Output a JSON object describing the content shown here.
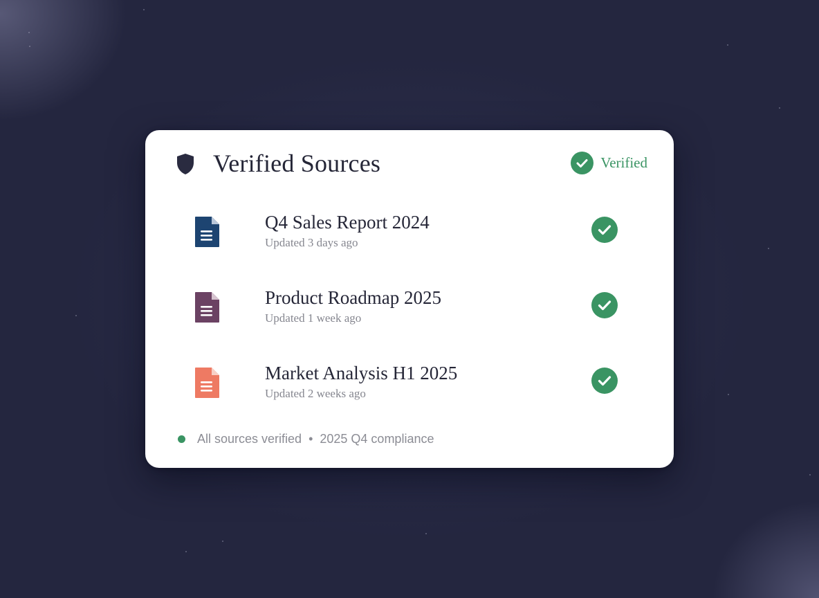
{
  "card": {
    "title": "Verified Sources",
    "title_icon": "shield-icon",
    "status_label": "Verified",
    "status_icon": "check-circle-icon"
  },
  "sources": [
    {
      "title": "Q4 Sales Report 2024",
      "updated": "Updated 3 days ago",
      "icon": "document-icon",
      "icon_color": "#1d4471",
      "verified": true
    },
    {
      "title": "Product Roadmap 2025",
      "updated": "Updated 1 week ago",
      "icon": "document-icon",
      "icon_color": "#6b4263",
      "verified": true
    },
    {
      "title": "Market Analysis H1 2025",
      "updated": "Updated 2 weeks ago",
      "icon": "document-icon",
      "icon_color": "#ee7a63",
      "verified": true
    }
  ],
  "footer": {
    "status": "All sources verified",
    "separator": "•",
    "compliance": "2025 Q4 compliance"
  },
  "colors": {
    "accent_green": "#3a9463",
    "title_text": "#252637",
    "secondary_text": "#85868f",
    "background": "#24263f",
    "shield": "#2a2b40"
  }
}
